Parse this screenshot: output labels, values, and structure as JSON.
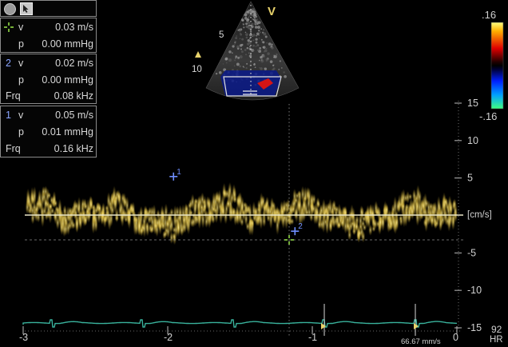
{
  "colors": {
    "spectral": "#e8d060",
    "baseline": "#e9e6c8",
    "ecg": "#39b29c",
    "marker_blue": "#6f8fff",
    "marker_green": "#9be84a",
    "triangle": "#e8d26b"
  },
  "toolbar": {
    "record_icon": "circle-icon",
    "cursor_icon": "pointer-icon"
  },
  "sector": {
    "orientation_marker": "V",
    "depth_labels": [
      "5",
      "10"
    ]
  },
  "measurements": [
    {
      "marker_label": "",
      "marker_icon": "crosshair-icon",
      "lines": [
        {
          "name": "v",
          "value": "0.03 m/s"
        },
        {
          "name": "p",
          "value": "0.00 mmHg"
        }
      ]
    },
    {
      "marker_label": "2",
      "lines": [
        {
          "name": "v",
          "value": "0.02 m/s"
        },
        {
          "name": "p",
          "value": "0.00 mmHg"
        },
        {
          "name": "Frq",
          "value": "0.08 kHz"
        }
      ]
    },
    {
      "marker_label": "1",
      "lines": [
        {
          "name": "v",
          "value": "0.05 m/s"
        },
        {
          "name": "p",
          "value": "0.01 mmHg"
        },
        {
          "name": "Frq",
          "value": "0.16 kHz"
        }
      ]
    }
  ],
  "color_bar": {
    "top_label": ".16",
    "bottom_label": "-.16"
  },
  "velocity_axis": {
    "unit_label": "[cm/s]",
    "ticks": [
      {
        "label": "15",
        "value": 15
      },
      {
        "label": "10",
        "value": 10
      },
      {
        "label": "5",
        "value": 5
      },
      {
        "label": "-5",
        "value": -5
      },
      {
        "label": "-10",
        "value": -10
      },
      {
        "label": "-15",
        "value": -15
      }
    ]
  },
  "time_axis": {
    "ticks": [
      {
        "label": "-3",
        "value": -3
      },
      {
        "label": "-2",
        "value": -2
      },
      {
        "label": "-1",
        "value": -1
      },
      {
        "label": "0",
        "value": 0
      }
    ],
    "sweep_speed": "66.67 mm/s"
  },
  "heart_rate": {
    "value": "92",
    "label": "HR"
  },
  "cursors": [
    {
      "label": "1",
      "t": -1.96,
      "v": 5.2
    },
    {
      "label": "2",
      "t": -1.12,
      "v": -2.1
    }
  ]
}
